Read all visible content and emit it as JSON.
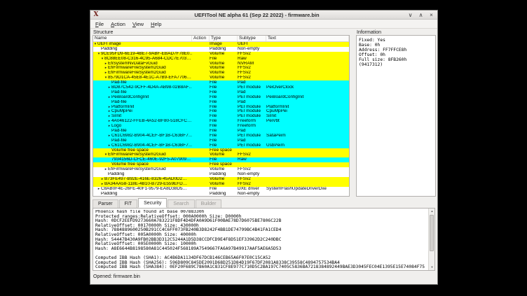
{
  "titlebar": {
    "title": "UEFITool NE alpha 61 (Sep 22 2022) - firmware.bin",
    "icon_letter": "X",
    "minimize": "∨",
    "maximize": "∧",
    "close": "×"
  },
  "menubar": {
    "items": [
      "File",
      "Action",
      "View",
      "Help"
    ]
  },
  "structure_panel": {
    "label": "Structure",
    "columns": [
      "Name",
      "Action",
      "Type",
      "Subtype",
      "Text"
    ],
    "rows": [
      {
        "level": 0,
        "arrow": "open",
        "name": "UEFI image",
        "action": "",
        "type": "Image",
        "subtype": "UEFI",
        "text": "",
        "bg": "yellow"
      },
      {
        "level": 1,
        "arrow": "none",
        "name": "Padding",
        "action": "",
        "type": "Padding",
        "subtype": "Non-empty",
        "text": "",
        "bg": "white"
      },
      {
        "level": 1,
        "arrow": "open",
        "name": "9CE95FD9-6E19-4BE7-9ABF-EBAD7F78E0…",
        "action": "",
        "type": "Volume",
        "subtype": "FFSv2",
        "text": "",
        "bg": "yellow"
      },
      {
        "level": 2,
        "arrow": "open",
        "name": "8C88EE08-C316-4C95-A684-CDC7E703…",
        "action": "",
        "type": "File",
        "subtype": "Raw",
        "text": "",
        "bg": "yellow"
      },
      {
        "level": 3,
        "arrow": "closed",
        "name": "EfiSystemNvDataFvGuid",
        "action": "",
        "type": "Volume",
        "subtype": "NVRAM",
        "text": "",
        "bg": "yellow"
      },
      {
        "level": 3,
        "arrow": "closed",
        "name": "EfiFirmwareFileSystem2Guid",
        "action": "",
        "type": "Volume",
        "subtype": "FFSv2",
        "text": "",
        "bg": "yellow"
      },
      {
        "level": 3,
        "arrow": "closed",
        "name": "EfiFirmwareFileSystem2Guid",
        "action": "",
        "type": "Volume",
        "subtype": "FFSv2",
        "text": "",
        "bg": "yellow"
      },
      {
        "level": 3,
        "arrow": "open",
        "name": "8579D1CA-45E8-4E1C-A7B9-EFA7706…",
        "action": "",
        "type": "Volume",
        "subtype": "FFSv2",
        "text": "",
        "bg": "yellow"
      },
      {
        "level": 4,
        "arrow": "none",
        "name": "Pad-file",
        "action": "",
        "type": "File",
        "subtype": "Pad",
        "text": "",
        "bg": "cyan"
      },
      {
        "level": 4,
        "arrow": "closed",
        "name": "BD87C542-9CFF-4D4A-AB98-02B8AF…",
        "action": "",
        "type": "File",
        "subtype": "PEI module",
        "text": "PeiOverClock",
        "bg": "cyan"
      },
      {
        "level": 4,
        "arrow": "none",
        "name": "Pad-file",
        "action": "",
        "type": "File",
        "subtype": "Pad",
        "text": "",
        "bg": "cyan"
      },
      {
        "level": 4,
        "arrow": "closed",
        "name": "PeiBoardConfigInit",
        "action": "",
        "type": "File",
        "subtype": "PEI module",
        "text": "PeiBoardConfigInit",
        "bg": "cyan"
      },
      {
        "level": 4,
        "arrow": "none",
        "name": "Pad-file",
        "action": "",
        "type": "File",
        "subtype": "Pad",
        "text": "",
        "bg": "cyan"
      },
      {
        "level": 4,
        "arrow": "closed",
        "name": "PlatformInit",
        "action": "",
        "type": "File",
        "subtype": "PEI module",
        "text": "PlatformInit",
        "bg": "cyan"
      },
      {
        "level": 4,
        "arrow": "closed",
        "name": "CpuMpPei",
        "action": "",
        "type": "File",
        "subtype": "PEI module",
        "text": "CpuMpPei",
        "bg": "cyan"
      },
      {
        "level": 4,
        "arrow": "closed",
        "name": "SiInit",
        "action": "",
        "type": "File",
        "subtype": "PEI module",
        "text": "SiInit",
        "bg": "cyan"
      },
      {
        "level": 4,
        "arrow": "closed",
        "name": "4A046122-FFEB-4A52-BF80-518CFC…",
        "action": "",
        "type": "File",
        "subtype": "Freeform",
        "text": "PeiVbt",
        "bg": "cyan"
      },
      {
        "level": 4,
        "arrow": "closed",
        "name": "Logo",
        "action": "",
        "type": "File",
        "subtype": "Freeform",
        "text": "",
        "bg": "cyan"
      },
      {
        "level": 4,
        "arrow": "none",
        "name": "Pad-file",
        "action": "",
        "type": "File",
        "subtype": "Pad",
        "text": "",
        "bg": "cyan"
      },
      {
        "level": 4,
        "arrow": "closed",
        "name": "C61C6982-B904-4CEF-BF1B-C63BF7…",
        "action": "",
        "type": "File",
        "subtype": "PEI module",
        "text": "SataPeim",
        "bg": "cyan"
      },
      {
        "level": 4,
        "arrow": "none",
        "name": "Pad-file",
        "action": "",
        "type": "File",
        "subtype": "Pad",
        "text": "",
        "bg": "cyan"
      },
      {
        "level": 4,
        "arrow": "closed",
        "name": "C61C6982-B904-4CEF-BF1B-C63BF7…",
        "action": "",
        "type": "File",
        "subtype": "PEI module",
        "text": "UsbPeim",
        "bg": "cyan"
      },
      {
        "level": 4,
        "arrow": "none",
        "name": "Volume free space",
        "action": "",
        "type": "Free space",
        "subtype": "",
        "text": "",
        "bg": "yellow"
      },
      {
        "level": 3,
        "arrow": "open",
        "name": "EfiFirmwareFileSystem2Guid",
        "action": "",
        "type": "Volume",
        "subtype": "FFSv2",
        "text": "",
        "bg": "yellow"
      },
      {
        "level": 4,
        "arrow": "none",
        "name": "7934156D-CFCE-460E-92F5-A07909…",
        "action": "",
        "type": "File",
        "subtype": "Raw",
        "text": "",
        "bg": "cyan"
      },
      {
        "level": 4,
        "arrow": "none",
        "name": "Volume free space",
        "action": "",
        "type": "Free space",
        "subtype": "",
        "text": "",
        "bg": "yellow"
      },
      {
        "level": 3,
        "arrow": "closed",
        "name": "EfiFirmwareFileSystem2Guid",
        "action": "",
        "type": "Volume",
        "subtype": "FFSv2",
        "text": "",
        "bg": "white"
      },
      {
        "level": 3,
        "arrow": "none",
        "name": "Padding",
        "action": "",
        "type": "Padding",
        "subtype": "Non-empty",
        "text": "",
        "bg": "white"
      },
      {
        "level": 2,
        "arrow": "closed",
        "name": "B73FE497-B92E-416E-8326-45AD0D2…",
        "action": "",
        "type": "Volume",
        "subtype": "FFSv2",
        "text": "",
        "bg": "yellow"
      },
      {
        "level": 2,
        "arrow": "closed",
        "name": "BA34AA58-118E-4B10-B729-E559EFD…",
        "action": "",
        "type": "Volume",
        "subtype": "FFSv2",
        "text": "",
        "bg": "yellow"
      },
      {
        "level": 1,
        "arrow": "closed",
        "name": "C8AB0F4E-26FE-40F1-9579-EA8D38D5…",
        "action": "",
        "type": "File",
        "subtype": "DXE driver",
        "text": "SystemFlashUpdateDriverDxe",
        "bg": "white"
      },
      {
        "level": 1,
        "arrow": "none",
        "name": "Padding",
        "action": "",
        "type": "Padding",
        "subtype": "Non-empty",
        "text": "",
        "bg": "white"
      }
    ]
  },
  "information_panel": {
    "label": "Information",
    "lines": [
      "Fixed: Yes",
      "Base: 0h",
      "Address: FF7FFCE8h",
      "Offset: 0h",
      "Full size: 8FB260h (9417312)"
    ]
  },
  "tabs": [
    {
      "label": "Parser",
      "state": "normal"
    },
    {
      "label": "FIT",
      "state": "normal"
    },
    {
      "label": "Security",
      "state": "active"
    },
    {
      "label": "Search",
      "state": "disabled"
    },
    {
      "label": "Builder",
      "state": "disabled"
    }
  ],
  "security_log": [
    "Phoenix hash file found at base 00788330h",
    "Protected ranges:RelativeOffset: 000A0000h Size: D0000h",
    "Hash: 0DCF2EEFD9273660A783221F8DF4D4DFA0A9D61F00BAE78D7D6075BE7806C22B",
    "RelativeOffset: 00170000h Size: 430000h",
    "Hash: 7884889600250B291CC4C6FF073FB240B3D8242F4BB1DE74799BC4B41FA1CED4",
    "RelativeOffset: 005A0000h Size: 40000h",
    "Hash: 54447B430A9FB02BB3D312C5244A1D5D38CCDFCD9E4F8D51EF33962D2C240DBC",
    "RelativeOffset: 005E0000h Size: 10000h",
    "Hash: A8E6644B8198580A81C445024F568189A7549667FA6A97B49917AAF5AE6A5D53",
    "",
    "Computed IBB Hash (SHA1): AC4B6DA1134DF67DCB146CEB65A6F07E0C15CA52",
    "Computed IBB Hash (SHA256): 596D809C845DE2091D68D251D84D19F67DF2081A8338C39558C4894757534BA4",
    "Computed IBB Hash (SHA384): 0EF20F689C7860A1C831CF8E977C710D5C2BA197C7405C5836BA7218384892449BAE3D3045FEC04E1395E15E74084F75"
  ],
  "statusbar": {
    "text": "Opened: firmware.bin"
  },
  "colors": {
    "row_yellow": "#ffff00",
    "row_cyan": "#00ffff",
    "row_white": "#ffffff",
    "window_bg": "#f0efed"
  }
}
